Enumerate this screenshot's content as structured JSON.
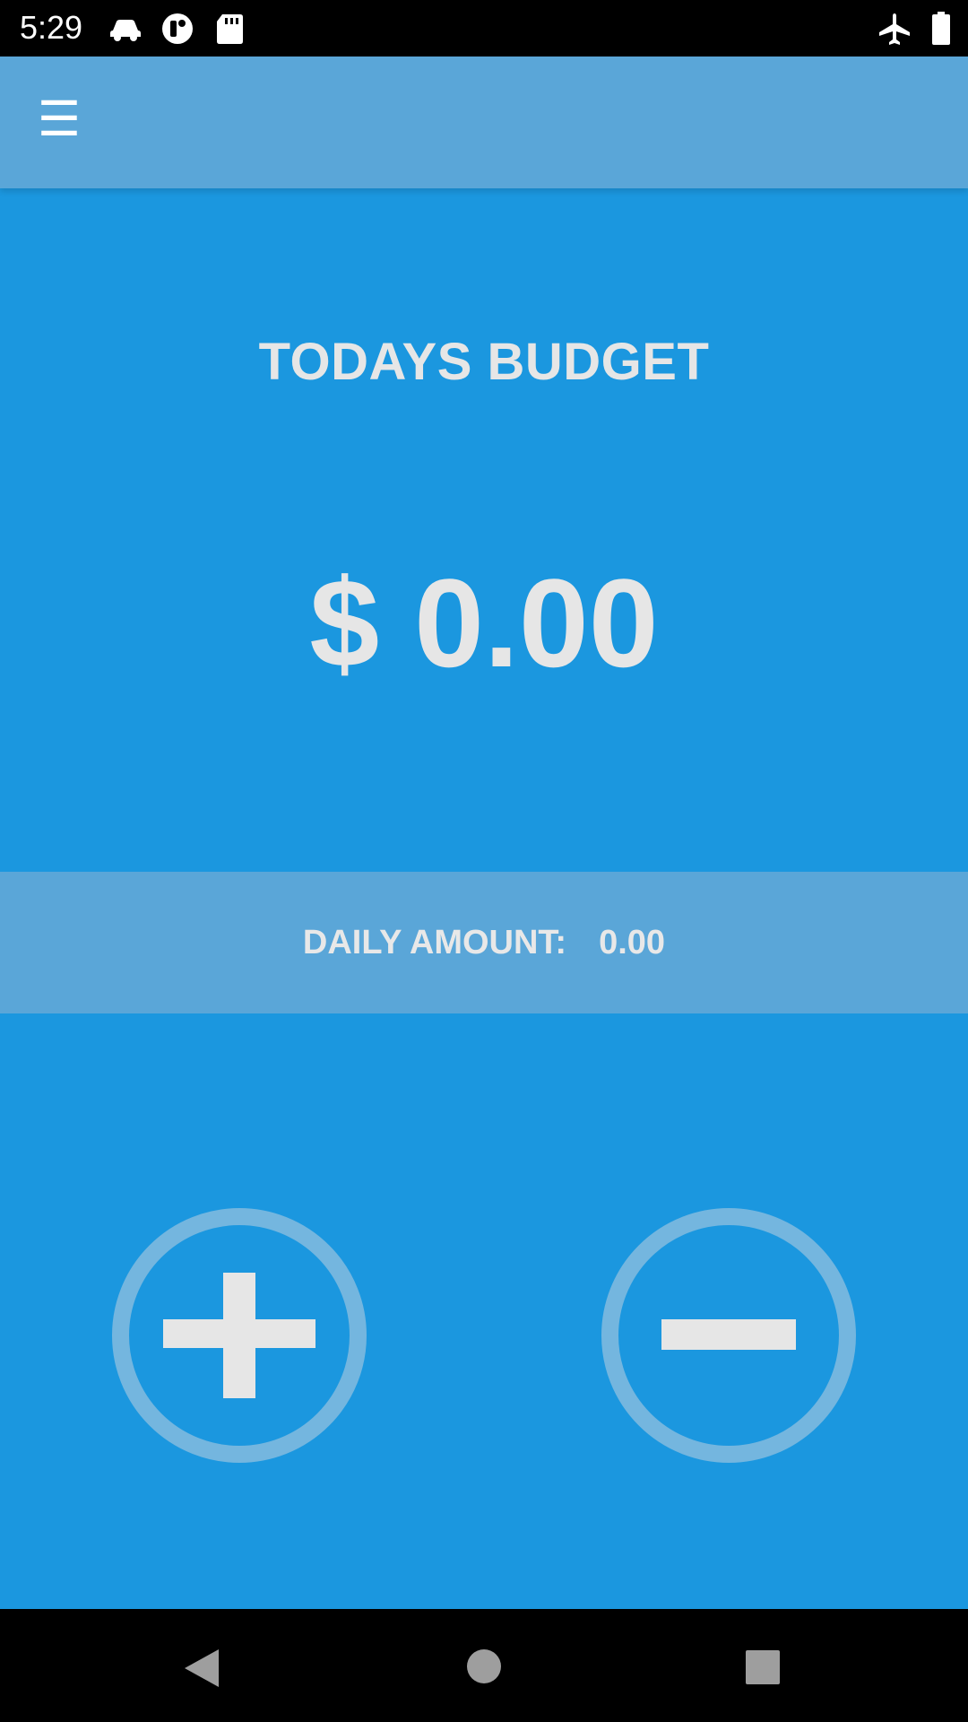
{
  "status_bar": {
    "time": "5:29",
    "icons": [
      "car-icon",
      "record-icon",
      "sd-card-icon",
      "airplane-mode-icon",
      "battery-icon"
    ]
  },
  "app_bar": {
    "menu_glyph": "☰",
    "menu_icon": "hamburger-menu-icon"
  },
  "main": {
    "title": "TODAYS BUDGET",
    "amount": "$ 0.00",
    "daily": {
      "label": "DAILY AMOUNT:",
      "value": "0.00"
    },
    "buttons": {
      "add_icon": "plus-icon",
      "subtract_icon": "minus-icon"
    }
  },
  "nav_bar": {
    "icons": [
      "back-icon",
      "home-icon",
      "recents-icon"
    ]
  },
  "colors": {
    "primary_background": "#1b97df",
    "app_bar_background": "#5aa6d8",
    "text": "#e6e6e6",
    "circle_ring": "#74b6df"
  }
}
